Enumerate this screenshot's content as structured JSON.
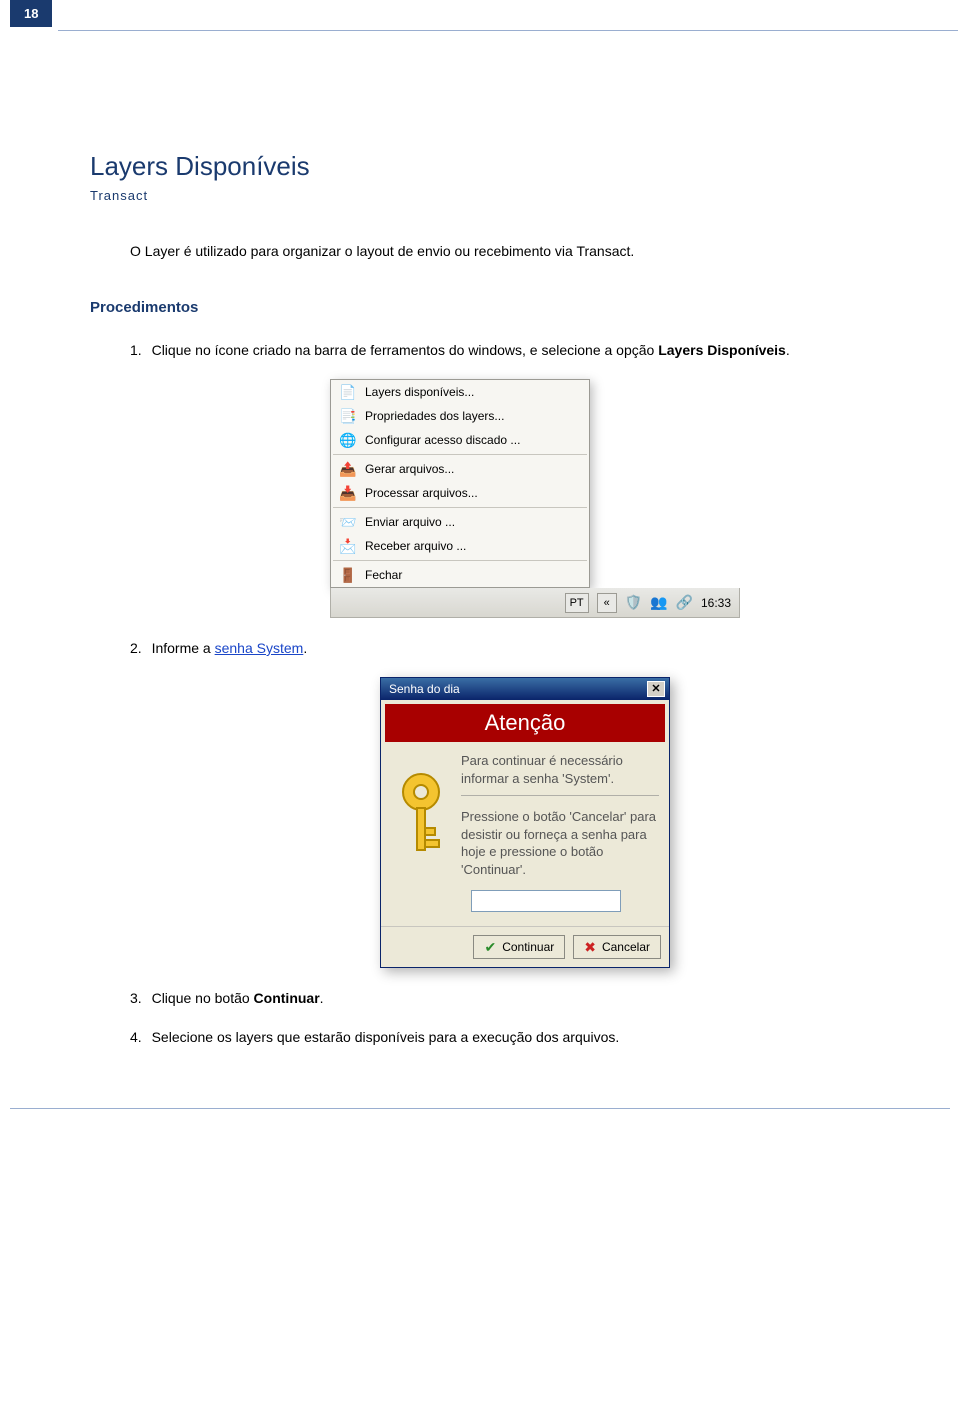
{
  "page_number": "18",
  "title": "Layers Disponíveis",
  "subtitle": "Transact",
  "intro": "O Layer é utilizado para organizar o layout de envio ou recebimento via Transact.",
  "procedimentos_heading": "Procedimentos",
  "steps": {
    "s1_prefix": "1.",
    "s1_a": "Clique no ícone criado na barra de ferramentos do windows, e selecione a opção ",
    "s1_bold": "Layers Disponíveis",
    "s1_suffix": ".",
    "s2_prefix": "2.",
    "s2_a": "Informe a ",
    "s2_link": "senha System",
    "s2_suffix": ".",
    "s3_prefix": "3.",
    "s3_a": "Clique no botão ",
    "s3_bold": "Continuar",
    "s3_suffix": ".",
    "s4_prefix": "4.",
    "s4_a": "Selecione os layers que estarão disponíveis para a execução dos arquivos."
  },
  "context_menu": {
    "items": [
      {
        "icon": "📄",
        "label": "Layers disponíveis..."
      },
      {
        "icon": "📑",
        "label": "Propriedades dos layers..."
      },
      {
        "icon": "🌐",
        "label": "Configurar acesso discado ..."
      }
    ],
    "group2": [
      {
        "icon": "📤",
        "label": "Gerar arquivos..."
      },
      {
        "icon": "📥",
        "label": "Processar arquivos..."
      }
    ],
    "group3": [
      {
        "icon": "📨",
        "label": "Enviar arquivo ..."
      },
      {
        "icon": "📩",
        "label": "Receber arquivo ..."
      }
    ],
    "group4": [
      {
        "icon": "🚪",
        "label": "Fechar"
      }
    ]
  },
  "taskbar": {
    "lang": "PT",
    "chev": "«",
    "clock": "16:33"
  },
  "dialog": {
    "title": "Senha do dia",
    "banner": "Atenção",
    "p1": "Para continuar é necessário informar a senha 'System'.",
    "p2": "Pressione o botão 'Cancelar' para desistir ou forneça a senha para hoje e pressione o botão 'Continuar'.",
    "input_value": "",
    "btn_ok": "Continuar",
    "btn_cancel": "Cancelar"
  }
}
